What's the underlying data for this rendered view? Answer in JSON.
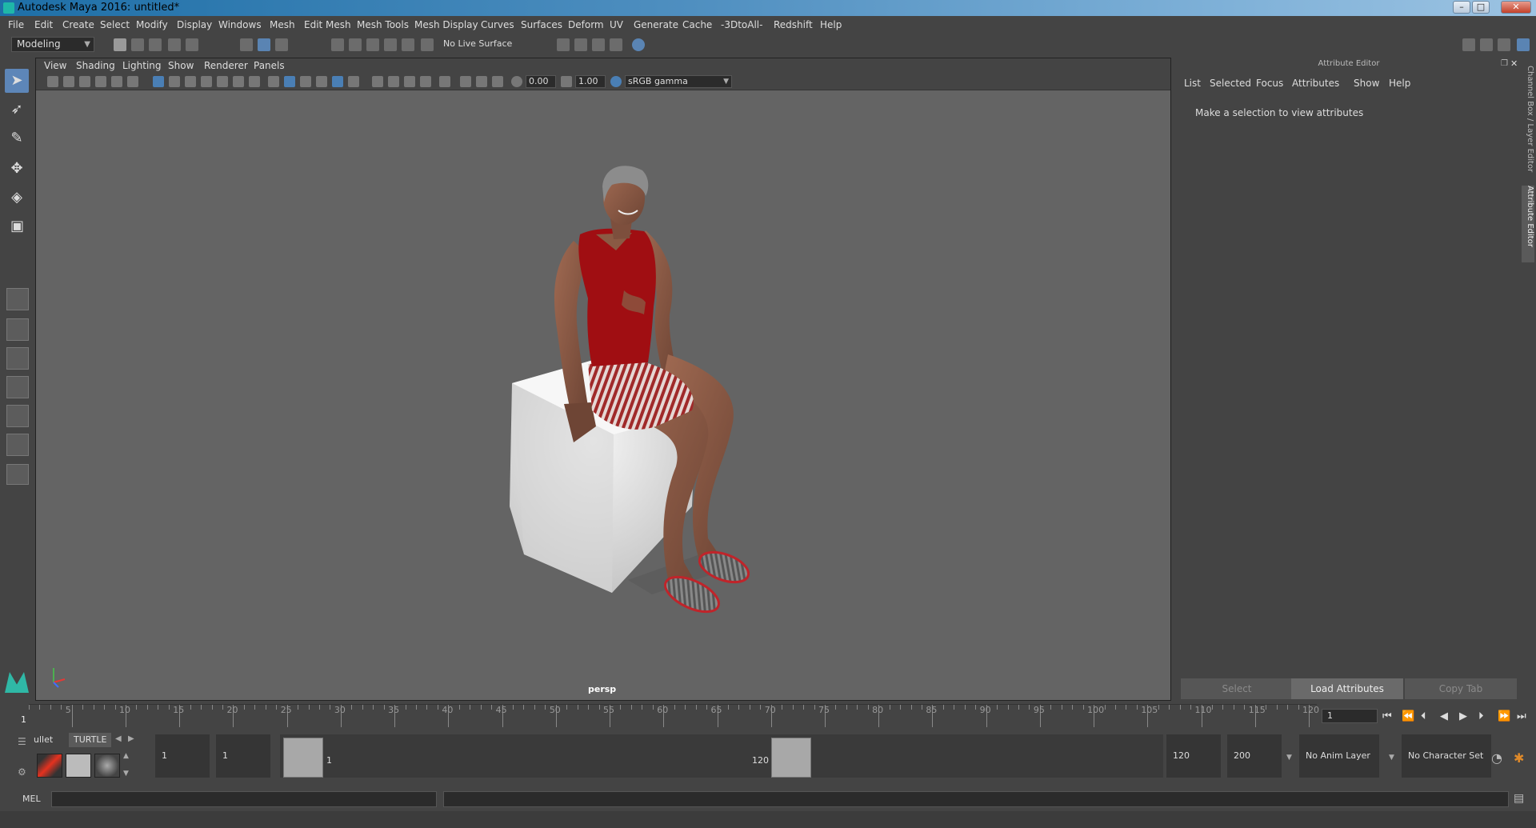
{
  "window": {
    "title": "Autodesk Maya 2016: untitled*",
    "minimize": "–",
    "maximize": "□",
    "close": "✕"
  },
  "menubar": [
    "File",
    "Edit",
    "Create",
    "Select",
    "Modify",
    "Display",
    "Windows",
    "Mesh",
    "Edit Mesh",
    "Mesh Tools",
    "Mesh Display",
    "Curves",
    "Surfaces",
    "Deform",
    "UV",
    "Generate",
    "Cache",
    "-3DtoAll-",
    "Redshift",
    "Help"
  ],
  "statusline": {
    "mode": "Modeling",
    "live_surface": "No Live Surface"
  },
  "viewport": {
    "menu": [
      "View",
      "Shading",
      "Lighting",
      "Show",
      "Renderer",
      "Panels"
    ],
    "exposure": "0.00",
    "gamma": "1.00",
    "colorspace": "sRGB gamma",
    "camera": "persp"
  },
  "attribute_editor": {
    "title": "Attribute Editor",
    "menu": [
      "List",
      "Selected",
      "Focus",
      "Attributes",
      "Show",
      "Help"
    ],
    "message": "Make a selection to view attributes",
    "buttons": {
      "select": "Select",
      "load": "Load Attributes",
      "copy": "Copy Tab"
    }
  },
  "side_tabs": {
    "channel_box": "Channel Box / Layer Editor",
    "attribute_editor": "Attribute Editor"
  },
  "timeline": {
    "ticks": [
      "5",
      "10",
      "15",
      "20",
      "25",
      "30",
      "35",
      "40",
      "45",
      "50",
      "55",
      "60",
      "65",
      "70",
      "75",
      "80",
      "85",
      "90",
      "95",
      "100",
      "105",
      "110",
      "115",
      "120"
    ],
    "current_frame": "1",
    "current_frame_field": "1"
  },
  "range": {
    "shelf_tabs": [
      "ullet",
      "TURTLE"
    ],
    "start_field": "1",
    "start_field2": "1",
    "range_start": "1",
    "range_end": "120",
    "end_field": "120",
    "end_field2": "200",
    "anim_layer": "No Anim Layer",
    "char_set": "No Character Set"
  },
  "cmdline": {
    "label": "MEL"
  },
  "colors": {
    "skin": "#8a5a44",
    "shirt": "#a00e12",
    "shoe_rim": "#c0242a",
    "cube": "#e6e6e6",
    "accent": "#5d86b8"
  }
}
